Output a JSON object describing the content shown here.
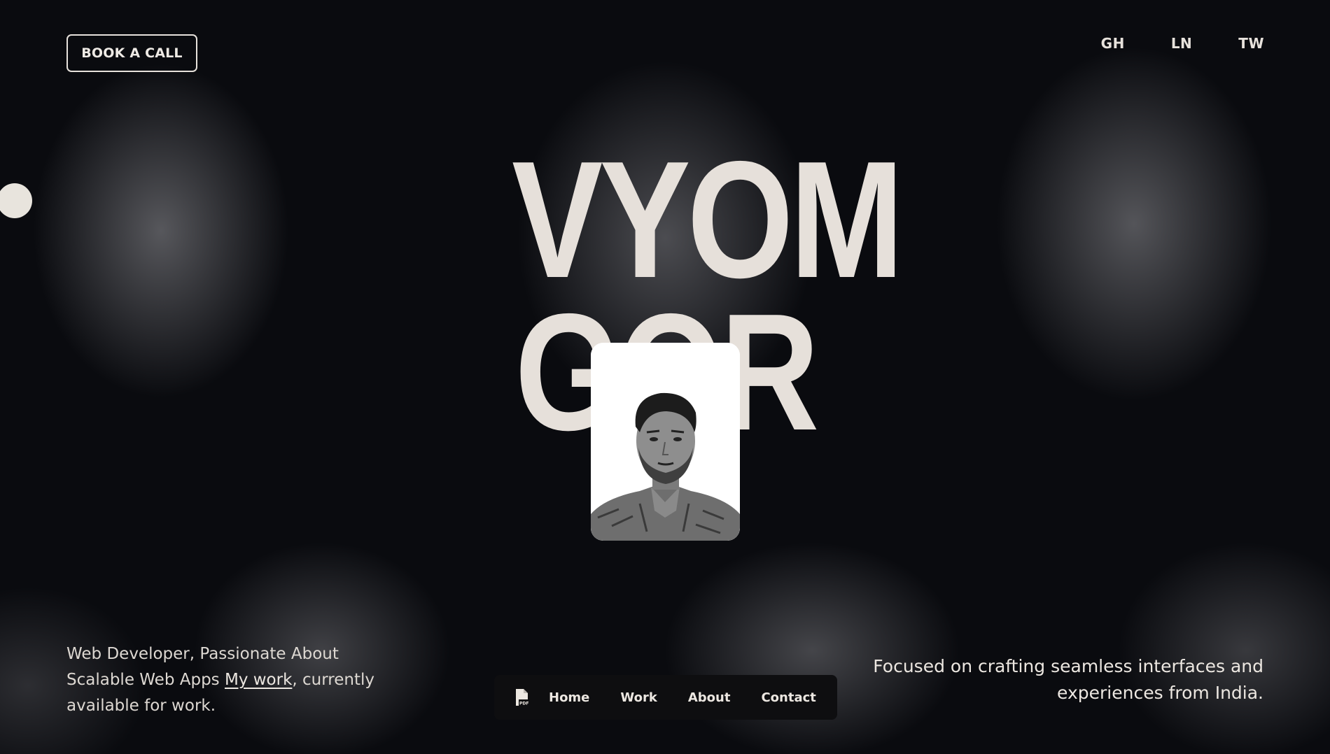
{
  "header": {
    "cta_label": "BOOK A CALL",
    "social": [
      "GH",
      "LN",
      "TW"
    ]
  },
  "hero": {
    "title_line1": "VYOM",
    "title_line2": "GOR"
  },
  "intro": {
    "text_before": "Web Developer, Passionate About Scalable Web Apps ",
    "link_label": "My work",
    "text_after": ", currently available for work."
  },
  "tagline": "Focused on crafting seamless interfaces and experiences from India.",
  "nav": {
    "resume_icon": "pdf-file-icon",
    "items": [
      "Home",
      "Work",
      "About",
      "Contact"
    ]
  },
  "colors": {
    "background": "#0a0b0f",
    "text": "#e7e2dc",
    "nav_bg": "#0e0e10"
  }
}
